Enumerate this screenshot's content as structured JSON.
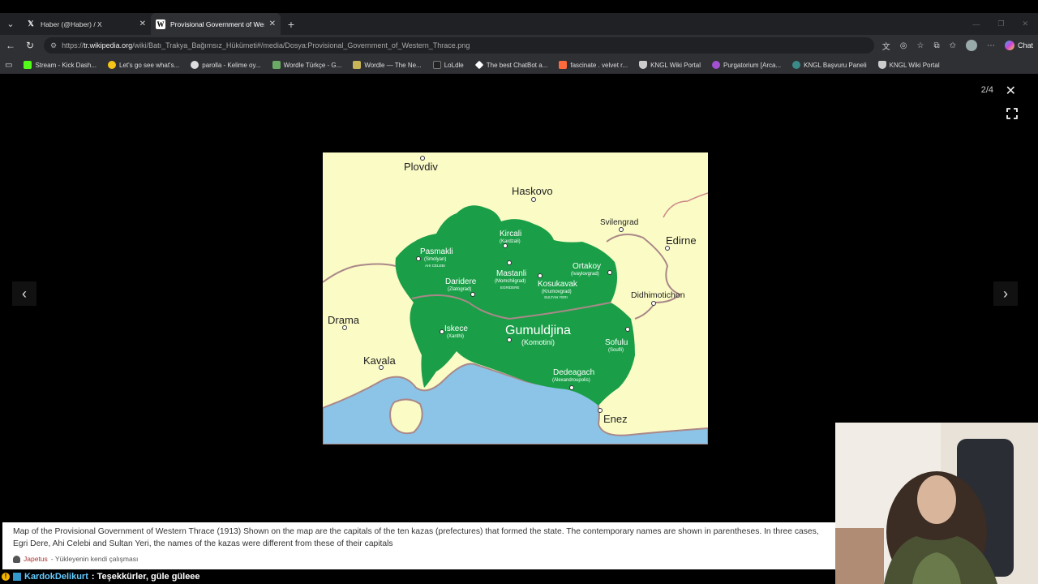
{
  "tabs": [
    {
      "title": "Haber (@Haber) / X",
      "icon": "x-logo-icon",
      "active": false
    },
    {
      "title": "Provisional Government of Western Thrace",
      "icon": "wikipedia-icon",
      "active": true
    }
  ],
  "address": {
    "prefix": "https://",
    "host": "tr.wikipedia.org",
    "path": "/wiki/Batı_Trakya_Bağımsız_Hükümeti#/media/Dosya:Provisional_Government_of_Western_Thrace.png"
  },
  "toolbar": {
    "chat_label": "Chat"
  },
  "bookmarks": [
    {
      "label": "Stream - Kick Dash...",
      "color": "#53fc18"
    },
    {
      "label": "Let's go see what's...",
      "color": "#f5c518"
    },
    {
      "label": "parolla - Kelime oy...",
      "color": "#dddddd"
    },
    {
      "label": "Wordle Türkçe - G...",
      "color": "#6aaa64"
    },
    {
      "label": "Wordle — The Ne...",
      "color": "#c9b458"
    },
    {
      "label": "LoLdle",
      "color": "#222222"
    },
    {
      "label": "The best ChatBot a...",
      "color": "#ffffff"
    },
    {
      "label": "fascinate . velvet r...",
      "color": "#ff6a3d"
    },
    {
      "label": "KNGL Wiki Portal",
      "color": "#cccccc"
    },
    {
      "label": "Purgatorium [Arca...",
      "color": "#a050d0"
    },
    {
      "label": "KNGL Başvuru Paneli",
      "color": "#3a8a8a"
    },
    {
      "label": "KNGL Wiki Portal",
      "color": "#cccccc"
    }
  ],
  "viewer": {
    "counter": "2/4"
  },
  "map_labels": {
    "plovdiv": "Plovdiv",
    "haskovo": "Haskovo",
    "svilengrad": "Svilengrad",
    "edirne": "Edirne",
    "kircali": "Kircali",
    "kircali_alt": "(Kardzali)",
    "pasmakli": "Pasmakli",
    "pasmakli_alt": "(Smolyan)",
    "pasmakli_note": "AHI CELEBI",
    "ortakoy": "Ortakoy",
    "ortakoy_alt": "(Ivaylovgrad)",
    "mastanli": "Mastanli",
    "mastanli_alt": "(Momchilgrad)",
    "mastanli_note": "EGRIDERE",
    "daridere": "Daridere",
    "daridere_alt": "(Zlatograd)",
    "kosukavak": "Kosukavak",
    "kosukavak_alt": "(Krumovgrad)",
    "kosukavak_note": "SULTAN YERI",
    "didhimotichon": "Didhimotichon",
    "drama": "Drama",
    "iskece": "Iskece",
    "iskece_alt": "(Xanthi)",
    "gumuldjina": "Gumuldjina",
    "gumuldjina_alt": "(Komotini)",
    "sofulu": "Sofulu",
    "sofulu_alt": "(Soufli)",
    "kavala": "Kavala",
    "dedeagach": "Dedeagach",
    "dedeagach_alt": "(Alexandroupolis)",
    "enez": "Enez"
  },
  "caption": {
    "text": "Map of the Provisional Government of Western Thrace (1913) Shown on the map are the capitals of the ten kazas (prefectures) that formed the state. The contemporary names are shown in parentheses. In three cases, Egri Dere, Ahi Celebi and Sultan Yeri, the names of the kazas were different from these of their capitals",
    "author": "Japetus",
    "source": " - Yükleyenin kendi çalışması"
  },
  "chat": {
    "user": "KardokDelikurt",
    "message": ": Teşekkürler, güle güleee"
  }
}
